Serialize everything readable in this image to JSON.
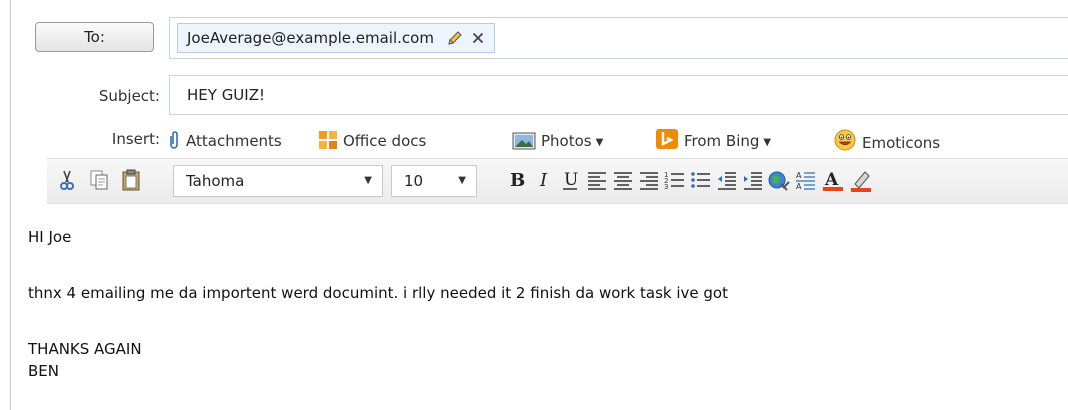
{
  "to": {
    "button_label": "To:",
    "recipient": "JoeAverage@example.email.com"
  },
  "subject": {
    "label": "Subject:",
    "value": "HEY GUIZ!"
  },
  "insert": {
    "label": "Insert:",
    "items": [
      {
        "label": "Attachments",
        "icon": "paperclip-icon"
      },
      {
        "label": "Office docs",
        "icon": "office-docs-icon"
      },
      {
        "label": "Photos",
        "icon": "photo-icon",
        "dropdown": true
      },
      {
        "label": "From Bing",
        "icon": "bing-icon",
        "dropdown": true
      },
      {
        "label": "Emoticons",
        "icon": "smiley-icon"
      }
    ]
  },
  "format_toolbar": {
    "font": "Tahoma",
    "size": "10",
    "icons": [
      "cut-icon",
      "copy-icon",
      "paste-icon",
      "bold-icon",
      "italic-icon",
      "underline-icon",
      "align-left-icon",
      "align-center-icon",
      "align-right-icon",
      "numbered-list-icon",
      "bulleted-list-icon",
      "decrease-indent-icon",
      "increase-indent-icon",
      "hyperlink-icon",
      "line-spacing-icon",
      "font-color-icon",
      "highlight-icon"
    ],
    "font_color": "#e8431c",
    "highlight_color": "#e8431c"
  },
  "body": {
    "lines": [
      "HI Joe",
      "thnx 4 emailing me da importent werd documint. i rlly needed it 2 finish da work task ive got",
      "THANKS AGAIN",
      "BEN"
    ]
  },
  "colors": {
    "chip_bg": "#eef4fc",
    "chip_border": "#b7cbe6",
    "field_border": "#c6d3e3"
  }
}
